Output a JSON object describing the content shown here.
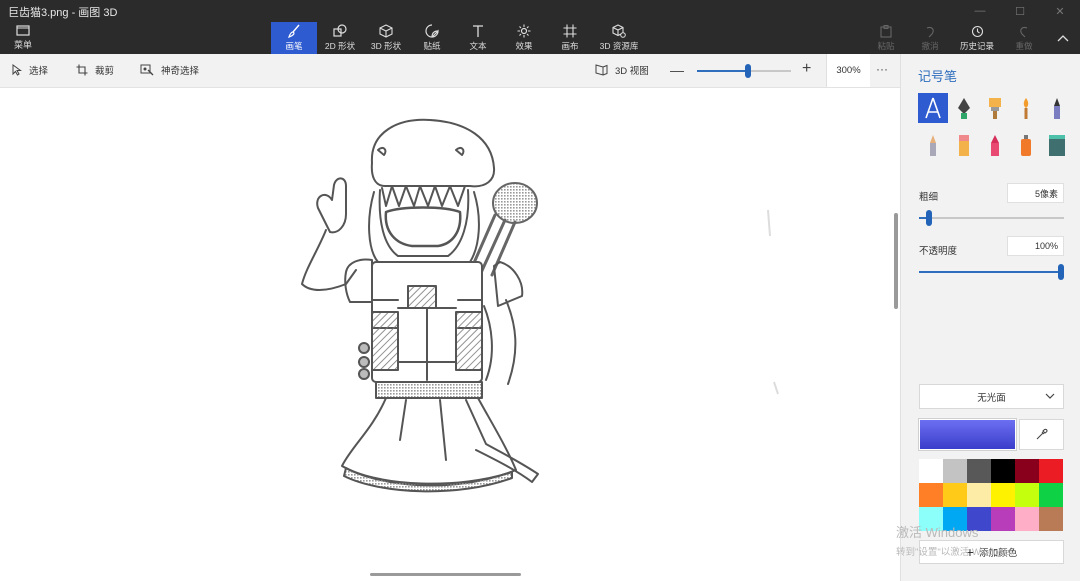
{
  "window": {
    "title": "巨齿猫3.png - 画图 3D"
  },
  "ribbon": {
    "menu_label": "菜单",
    "tools": [
      {
        "label": "画笔",
        "icon": "brush-icon",
        "active": true
      },
      {
        "label": "2D 形状",
        "icon": "shapes-2d-icon"
      },
      {
        "label": "3D 形状",
        "icon": "cube-icon"
      },
      {
        "label": "贴纸",
        "icon": "sticker-icon"
      },
      {
        "label": "文本",
        "icon": "text-icon"
      },
      {
        "label": "效果",
        "icon": "effects-icon"
      },
      {
        "label": "画布",
        "icon": "canvas-icon"
      },
      {
        "label": "3D 资源库",
        "icon": "library-3d-icon"
      }
    ],
    "right": {
      "paste": "粘贴",
      "undo": "撤消",
      "history": "历史记录",
      "redo": "重做"
    }
  },
  "toolbar": {
    "select": "选择",
    "crop": "裁剪",
    "magic_select": "神奇选择",
    "view_3d": "3D 视图",
    "zoom_percent": "300%",
    "zoom_level": 0.55,
    "more": "···"
  },
  "panel": {
    "title": "记号笔",
    "brushes": [
      {
        "icon": "marker-icon",
        "active": true
      },
      {
        "icon": "calligraphy-pen-icon"
      },
      {
        "icon": "oil-brush-icon"
      },
      {
        "icon": "watercolor-icon"
      },
      {
        "icon": "pixel-pen-icon"
      },
      {
        "icon": "pencil-icon"
      },
      {
        "icon": "eraser-icon"
      },
      {
        "icon": "crayon-icon"
      },
      {
        "icon": "spray-can-icon"
      },
      {
        "icon": "fill-bucket-icon"
      }
    ],
    "thickness_label": "粗细",
    "thickness_value": "5像素",
    "thickness_level": 0.05,
    "opacity_label": "不透明度",
    "opacity_value": "100%",
    "opacity_level": 1.0,
    "finish_value": "无光面",
    "current_color": "#4a4ed8",
    "palette": [
      "#ffffff",
      "#c3c3c3",
      "#585858",
      "#000000",
      "#88001b",
      "#ec1c24",
      "#ff7f27",
      "#ffca18",
      "#fdeca6",
      "#fff200",
      "#c4ff0e",
      "#0ed145",
      "#8cfffb",
      "#00a8f3",
      "#3f48cc",
      "#b83dba",
      "#ffaec8",
      "#b97a56"
    ],
    "add_color_label": "添加颜色"
  },
  "watermark": {
    "line1": "激活 Windows",
    "line2": "转到\"设置\"以激活 Windows。"
  }
}
